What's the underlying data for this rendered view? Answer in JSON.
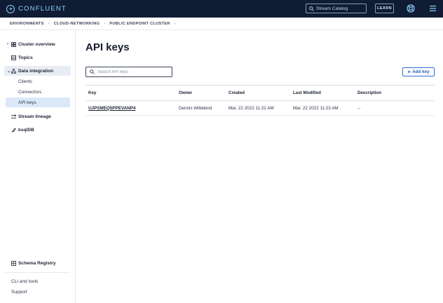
{
  "topbar": {
    "brand": "CONFLUENT",
    "search_placeholder": "Stream Catalog",
    "learn_label": "LEARN"
  },
  "breadcrumb": [
    "ENVIRONMENTS",
    "CLOUD-NETWORKING",
    "PUBLIC ENDPOINT CLUSTER"
  ],
  "sidebar": {
    "items": [
      {
        "label": "Cluster overview",
        "icon": "grid-icon",
        "chevron": "right"
      },
      {
        "label": "Topics",
        "icon": "topics-icon"
      },
      {
        "label": "Data integration",
        "icon": "data-integration-icon",
        "chevron": "down",
        "selected": true
      },
      {
        "label": "Stream lineage",
        "icon": "lineage-icon"
      },
      {
        "label": "ksqlDB",
        "icon": "ksqldb-icon"
      },
      {
        "label": "Schema Registry",
        "icon": "schema-registry-icon"
      }
    ],
    "subitems": [
      {
        "label": "Clients"
      },
      {
        "label": "Connectors"
      },
      {
        "label": "API keys",
        "selected": true
      }
    ],
    "bottom_links": [
      "CLI and tools",
      "Support"
    ]
  },
  "main": {
    "title": "API keys",
    "search_placeholder": "Search API keys",
    "add_button_label": "Add key",
    "table": {
      "columns": [
        "Key",
        "Owner",
        "Created",
        "Last Modified",
        "Description"
      ],
      "rows": [
        {
          "key": "UJPSMEQ5PPEVANP4",
          "owner": "Dennis Wittekind",
          "created": "Mar. 22 2022 11:22 AM",
          "last_modified": "Mar. 22 2022 11:23 AM",
          "description": "--"
        }
      ]
    }
  },
  "colors": {
    "topbar_bg": "#0f1c33",
    "brand": "#8fd0ff",
    "accent": "#1f5fc2",
    "selected_bg": "#dbe8f8"
  }
}
